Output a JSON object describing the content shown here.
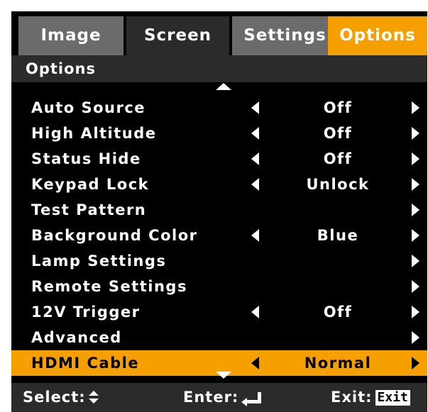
{
  "tabs": [
    {
      "label": "Image",
      "active": false
    },
    {
      "label": "Screen",
      "active": false
    },
    {
      "label": "Settings",
      "active": false
    },
    {
      "label": "Options",
      "active": true
    }
  ],
  "section_title": "Options",
  "menu_items": [
    {
      "label": "Auto Source",
      "value": "Off",
      "has_left_arrow": true,
      "has_right_arrow": true
    },
    {
      "label": "High Altitude",
      "value": "Off",
      "has_left_arrow": true,
      "has_right_arrow": true
    },
    {
      "label": "Status Hide",
      "value": "Off",
      "has_left_arrow": true,
      "has_right_arrow": true
    },
    {
      "label": "Keypad Lock",
      "value": "Unlock",
      "has_left_arrow": true,
      "has_right_arrow": true
    },
    {
      "label": "Test Pattern",
      "value": "",
      "has_left_arrow": false,
      "has_right_arrow": true
    },
    {
      "label": "Background Color",
      "value": "Blue",
      "has_left_arrow": true,
      "has_right_arrow": true
    },
    {
      "label": "Lamp Settings",
      "value": "",
      "has_left_arrow": false,
      "has_right_arrow": true
    },
    {
      "label": "Remote Settings",
      "value": "",
      "has_left_arrow": false,
      "has_right_arrow": true
    },
    {
      "label": "12V Trigger",
      "value": "Off",
      "has_left_arrow": true,
      "has_right_arrow": true
    },
    {
      "label": "Advanced",
      "value": "",
      "has_left_arrow": false,
      "has_right_arrow": true
    },
    {
      "label": "HDMI Cable",
      "value": "Normal",
      "has_left_arrow": true,
      "has_right_arrow": true,
      "selected": true
    }
  ],
  "footer": {
    "select_label": "Select:",
    "select_icon": "up-down-icon",
    "enter_label": "Enter:",
    "enter_icon": "enter-return-icon",
    "exit_label": "Exit:",
    "exit_key": "Exit"
  },
  "colors": {
    "accent": "#f6a000",
    "inactive_tab": "#6b6b6b",
    "dark_tab": "#2b2b2b",
    "background": "#000000",
    "text": "#ffffff"
  }
}
